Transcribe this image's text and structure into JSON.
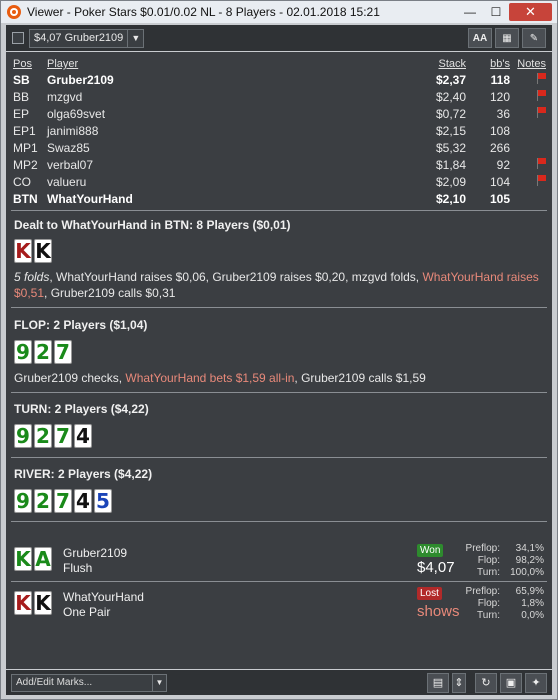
{
  "window": {
    "title": "Viewer - Poker Stars $0.01/0.02 NL - 8 Players - 02.01.2018 15:21",
    "minimize": "—",
    "maximize": "☐",
    "close": "✕"
  },
  "toolbar": {
    "hand_selector": "$4,07 Gruber2109",
    "font_button": "AA",
    "grid_button": "▦",
    "edit_button": "✎"
  },
  "players_table": {
    "headers": {
      "pos": "Pos",
      "player": "Player",
      "stack": "Stack",
      "bbs": "bb's",
      "notes": "Notes"
    },
    "rows": [
      {
        "pos": "SB",
        "player": "Gruber2109",
        "stack": "$2,37",
        "bbs": "118",
        "note_flag": true,
        "bold": true
      },
      {
        "pos": "BB",
        "player": "mzgvd",
        "stack": "$2,40",
        "bbs": "120",
        "note_flag": true,
        "bold": false
      },
      {
        "pos": "EP",
        "player": "olga69svet",
        "stack": "$0,72",
        "bbs": "36",
        "note_flag": true,
        "bold": false
      },
      {
        "pos": "EP1",
        "player": "janimi888",
        "stack": "$2,15",
        "bbs": "108",
        "note_flag": false,
        "bold": false
      },
      {
        "pos": "MP1",
        "player": "Swaz85",
        "stack": "$5,32",
        "bbs": "266",
        "note_flag": false,
        "bold": false
      },
      {
        "pos": "MP2",
        "player": "verbal07",
        "stack": "$1,84",
        "bbs": "92",
        "note_flag": true,
        "bold": false
      },
      {
        "pos": "CO",
        "player": "valueru",
        "stack": "$2,09",
        "bbs": "104",
        "note_flag": true,
        "bold": false
      },
      {
        "pos": "BTN",
        "player": "WhatYourHand",
        "stack": "$2,10",
        "bbs": "105",
        "note_flag": false,
        "bold": true
      }
    ]
  },
  "preflop": {
    "title": "Dealt to WhatYourHand in BTN: 8 Players ($0,01)",
    "cards": [
      {
        "rank": "K",
        "color": "red"
      },
      {
        "rank": "K",
        "color": "black"
      }
    ],
    "action_folds": "5 folds",
    "action_1": ", WhatYourHand raises $0,06, Gruber2109 raises $0,20, mzgvd folds, ",
    "action_hl": "WhatYourHand raises $0,51",
    "action_2": ", Gruber2109 calls $0,31"
  },
  "flop": {
    "title": "FLOP: 2 Players ($1,04)",
    "cards": [
      {
        "rank": "9",
        "color": "green"
      },
      {
        "rank": "2",
        "color": "green"
      },
      {
        "rank": "7",
        "color": "green"
      }
    ],
    "action_1": "Gruber2109 checks, ",
    "action_hl": "WhatYourHand bets $1,59 all-in",
    "action_2": ", Gruber2109 calls $1,59"
  },
  "turn": {
    "title": "TURN: 2 Players ($4,22)",
    "cards": [
      {
        "rank": "9",
        "color": "green"
      },
      {
        "rank": "2",
        "color": "green"
      },
      {
        "rank": "7",
        "color": "green"
      },
      {
        "rank": "4",
        "color": "black"
      }
    ]
  },
  "river": {
    "title": "RIVER: 2 Players ($4,22)",
    "cards": [
      {
        "rank": "9",
        "color": "green"
      },
      {
        "rank": "2",
        "color": "green"
      },
      {
        "rank": "7",
        "color": "green"
      },
      {
        "rank": "4",
        "color": "black"
      },
      {
        "rank": "5",
        "color": "blue"
      }
    ]
  },
  "results": [
    {
      "cards": [
        {
          "rank": "K",
          "color": "green"
        },
        {
          "rank": "A",
          "color": "green"
        }
      ],
      "player": "Gruber2109",
      "hand": "Flush",
      "badge": "Won",
      "amount": "$4,07",
      "equity": [
        {
          "label": "Preflop:",
          "value": "34,1%"
        },
        {
          "label": "Flop:",
          "value": "98,2%"
        },
        {
          "label": "Turn:",
          "value": "100,0%"
        }
      ]
    },
    {
      "cards": [
        {
          "rank": "K",
          "color": "red"
        },
        {
          "rank": "K",
          "color": "black"
        }
      ],
      "player": "WhatYourHand",
      "hand": "One Pair",
      "badge": "Lost",
      "amount": "shows",
      "equity": [
        {
          "label": "Preflop:",
          "value": "65,9%"
        },
        {
          "label": "Flop:",
          "value": "1,8%"
        },
        {
          "label": "Turn:",
          "value": "0,0%"
        }
      ]
    }
  ],
  "statusbar": {
    "marks_placeholder": "Add/Edit Marks...",
    "calendar": "▤",
    "spinner": "⇕",
    "replay": "↻",
    "save": "▣",
    "twitter": "✦"
  },
  "colors": {
    "card_red": "#a61c1c",
    "card_green": "#1a8a1a",
    "card_blue": "#1a44b8",
    "highlight": "#e8897a",
    "won": "#2e8b2e",
    "lost": "#b12a2a"
  }
}
